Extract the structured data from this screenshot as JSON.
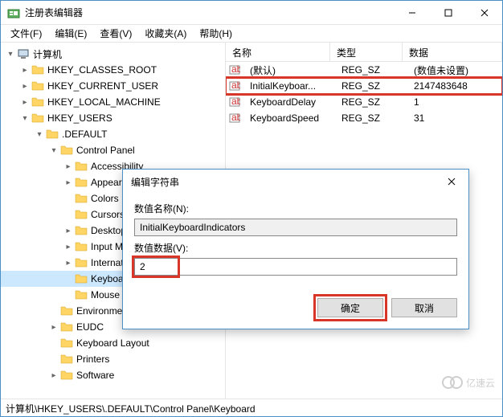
{
  "title": "注册表编辑器",
  "menu": [
    "文件(F)",
    "编辑(E)",
    "查看(V)",
    "收藏夹(A)",
    "帮助(H)"
  ],
  "tree": {
    "root": "计算机",
    "items": [
      "HKEY_CLASSES_ROOT",
      "HKEY_CURRENT_USER",
      "HKEY_LOCAL_MACHINE",
      "HKEY_USERS",
      ".DEFAULT",
      "Control Panel",
      "Accessibility",
      "Appearance",
      "Colors",
      "Cursors",
      "Desktop",
      "Input Method",
      "International",
      "Keyboard",
      "Mouse",
      "Environment",
      "EUDC",
      "Keyboard Layout",
      "Printers",
      "Software"
    ]
  },
  "list": {
    "headers": {
      "name": "名称",
      "type": "类型",
      "data": "数据"
    },
    "rows": [
      {
        "name": "(默认)",
        "type": "REG_SZ",
        "data": "(数值未设置)"
      },
      {
        "name": "InitialKeyboar...",
        "type": "REG_SZ",
        "data": "2147483648"
      },
      {
        "name": "KeyboardDelay",
        "type": "REG_SZ",
        "data": "1"
      },
      {
        "name": "KeyboardSpeed",
        "type": "REG_SZ",
        "data": "31"
      }
    ]
  },
  "dialog": {
    "title": "编辑字符串",
    "name_label": "数值名称(N):",
    "name_value": "InitialKeyboardIndicators",
    "data_label": "数值数据(V):",
    "data_value": "2",
    "ok": "确定",
    "cancel": "取消"
  },
  "statusbar": "计算机\\HKEY_USERS\\.DEFAULT\\Control Panel\\Keyboard",
  "watermark": "亿速云"
}
